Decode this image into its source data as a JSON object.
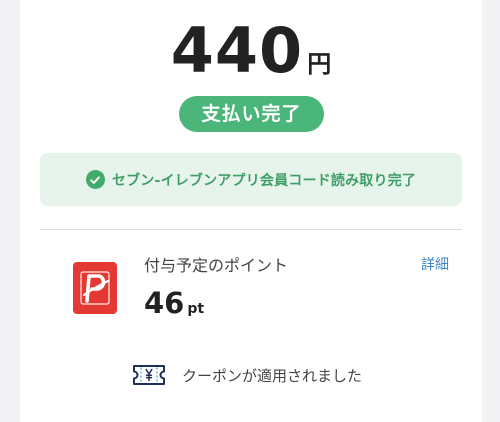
{
  "payment": {
    "amount": "440",
    "currency_unit": "円",
    "status_label": "支払い完了"
  },
  "notice": {
    "icon": "check-circle-icon",
    "text": "セブン-イレブンアプリ会員コード読み取り完了"
  },
  "points": {
    "logo": "paypay-logo",
    "label": "付与予定のポイント",
    "details_link": "詳細",
    "value": "46",
    "unit": "pt"
  },
  "coupon": {
    "icon": "coupon-ticket-icon",
    "text": "クーポンが適用されました"
  },
  "colors": {
    "success_green": "#4bb679",
    "notice_background": "#e6f4ec",
    "link_blue": "#3a86c8",
    "paypay_red": "#e43833",
    "coupon_icon_navy": "#1e2f5a"
  }
}
